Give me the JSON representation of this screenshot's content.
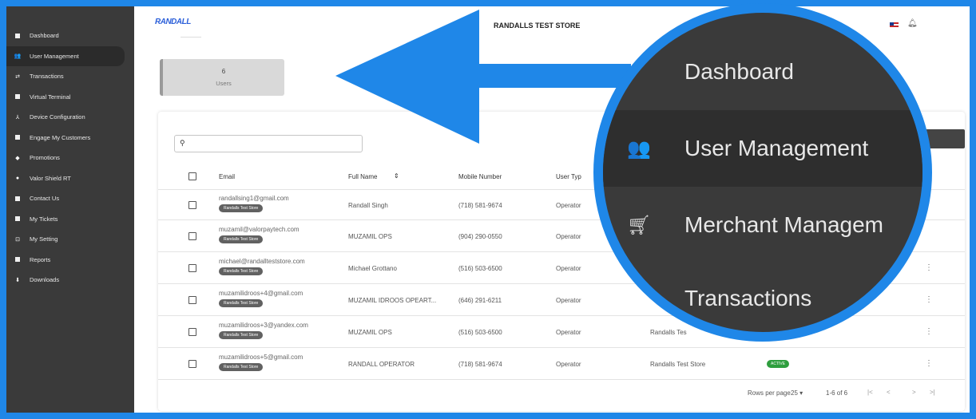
{
  "sidebar": {
    "items": [
      {
        "label": "Dashboard",
        "icon": "dashboard-icon"
      },
      {
        "label": "User Management",
        "icon": "users-icon",
        "active": true
      },
      {
        "label": "Transactions",
        "icon": "transactions-icon"
      },
      {
        "label": "Virtual Terminal",
        "icon": "terminal-icon"
      },
      {
        "label": "Device Configuration",
        "icon": "device-icon"
      },
      {
        "label": "Engage My Customers",
        "icon": "engage-icon"
      },
      {
        "label": "Promotions",
        "icon": "tag-icon"
      },
      {
        "label": "Valor Shield RT",
        "icon": "shield-icon"
      },
      {
        "label": "Contact Us",
        "icon": "contact-icon"
      },
      {
        "label": "My Tickets",
        "icon": "ticket-icon"
      },
      {
        "label": "My Setting",
        "icon": "settings-icon"
      },
      {
        "label": "Reports",
        "icon": "report-icon"
      },
      {
        "label": "Downloads",
        "icon": "download-icon"
      }
    ]
  },
  "header": {
    "logo": "RANDALL",
    "store_name": "RANDALLS TEST STORE"
  },
  "summary": {
    "count": "6",
    "label": "Users"
  },
  "table": {
    "columns": [
      "Email",
      "Full Name",
      "Mobile Number",
      "User Typ"
    ],
    "rows": [
      {
        "email": "randallsing1@gmail.com",
        "store_tag": "Randalls Test Store",
        "name": "Randall Singh",
        "mobile": "(718) 581-9674",
        "type": "Operator",
        "store": "",
        "status": ""
      },
      {
        "email": "muzamil@valorpaytech.com",
        "store_tag": "Randalls Test Store",
        "name": "MUZAMIL OPS",
        "mobile": "(904) 290-0550",
        "type": "Operator",
        "store": "",
        "status": ""
      },
      {
        "email": "michael@randallteststore.com",
        "store_tag": "Randalls Test Store",
        "name": "Michael Grottano",
        "mobile": "(516) 503-6500",
        "type": "Operator",
        "store": "",
        "status": ""
      },
      {
        "email": "muzamilidroos+4@gmail.com",
        "store_tag": "Randalls Test Store",
        "name": "MUZAMIL IDROOS OPEART...",
        "mobile": "(646) 291-6211",
        "type": "Operator",
        "store": "",
        "status": ""
      },
      {
        "email": "muzamilidroos+3@yandex.com",
        "store_tag": "Randalls Test Store",
        "name": "MUZAMIL OPS",
        "mobile": "(516) 503-6500",
        "type": "Operator",
        "store": "Randalls Tes",
        "status": ""
      },
      {
        "email": "muzamilidroos+5@gmail.com",
        "store_tag": "Randalls Test Store",
        "name": "RANDALL OPERATOR",
        "mobile": "(718) 581-9674",
        "type": "Operator",
        "store": "Randalls Test Store",
        "status": "ACTIVE"
      }
    ]
  },
  "pagination": {
    "rows_per_page_label": "Rows per page",
    "rows_per_page": "25",
    "range": "1-6 of 6"
  },
  "magnifier": {
    "items": [
      "Dashboard",
      "User Management",
      "Merchant Managem",
      "Transactions"
    ]
  },
  "colors": {
    "accent_blue": "#1f87e8",
    "sidebar_bg": "#3a3a3a",
    "active_green": "#2e9e3e"
  }
}
